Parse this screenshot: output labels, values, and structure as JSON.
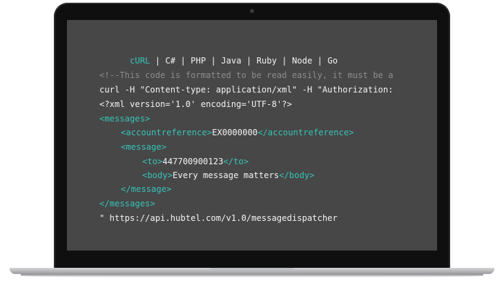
{
  "tabs": [
    {
      "label": "cURL",
      "active": true
    },
    {
      "label": "C#",
      "active": false
    },
    {
      "label": "PHP",
      "active": false
    },
    {
      "label": "Java",
      "active": false
    },
    {
      "label": "Ruby",
      "active": false
    },
    {
      "label": "Node",
      "active": false
    },
    {
      "label": "Go",
      "active": false
    }
  ],
  "separator": "|",
  "code": {
    "comment": "<!--This code is formatted to be read easily, it must be a",
    "curl_line": "curl -H \"Content-type: application/xml\" -H \"Authorization:",
    "xml_decl": "<?xml version='1.0' encoding='UTF-8'?>",
    "messages_open": "<messages>",
    "accountreference_open": "<accountreference>",
    "accountreference_value": "EX0000000",
    "accountreference_close": "</accountreference>",
    "message_open": "<message>",
    "to_open": "<to>",
    "to_value": "447700900123",
    "to_close": "</to>",
    "body_open": "<body>",
    "body_value": "Every message matters",
    "body_close": "</body>",
    "message_close": "</message>",
    "messages_close": "</messages>",
    "url_line": "\" https://api.hubtel.com/v1.0/messagedispatcher"
  },
  "colors": {
    "accent": "#36c3b7",
    "screen": "#474747",
    "comment": "#8d8d8d",
    "text": "#f4f4f4"
  }
}
